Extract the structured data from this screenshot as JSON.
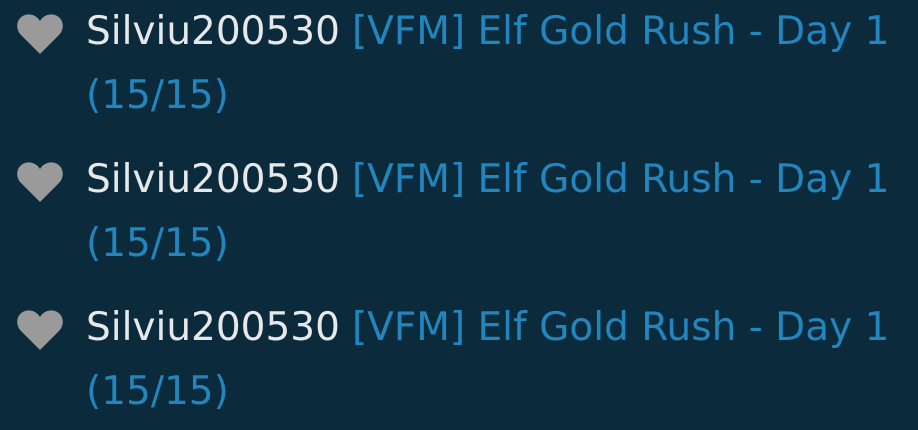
{
  "theme": {
    "background": "#0b2b3d",
    "username_color": "#e6e8ea",
    "link_color": "#2285bd",
    "heart_color": "#9a9a9a"
  },
  "feed": {
    "items": [
      {
        "icon": "heart-icon",
        "username": "Silviu200530",
        "quest_title": "[VFM] Elf Gold Rush - Day 1",
        "quest_progress": "(15/15)"
      },
      {
        "icon": "heart-icon",
        "username": "Silviu200530",
        "quest_title": "[VFM] Elf Gold Rush - Day 1",
        "quest_progress": "(15/15)"
      },
      {
        "icon": "heart-icon",
        "username": "Silviu200530",
        "quest_title": "[VFM] Elf Gold Rush - Day 1",
        "quest_progress": "(15/15)"
      }
    ]
  }
}
